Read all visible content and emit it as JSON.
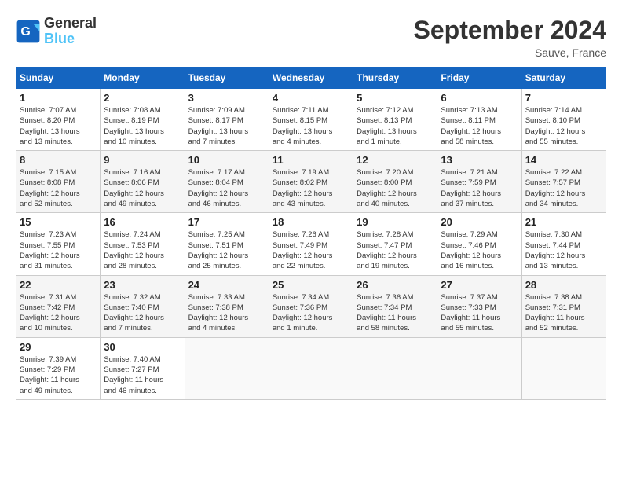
{
  "header": {
    "logo_line1": "General",
    "logo_line2": "Blue",
    "month": "September 2024",
    "location": "Sauve, France"
  },
  "weekdays": [
    "Sunday",
    "Monday",
    "Tuesday",
    "Wednesday",
    "Thursday",
    "Friday",
    "Saturday"
  ],
  "weeks": [
    [
      {
        "day": "1",
        "info": "Sunrise: 7:07 AM\nSunset: 8:20 PM\nDaylight: 13 hours\nand 13 minutes."
      },
      {
        "day": "2",
        "info": "Sunrise: 7:08 AM\nSunset: 8:19 PM\nDaylight: 13 hours\nand 10 minutes."
      },
      {
        "day": "3",
        "info": "Sunrise: 7:09 AM\nSunset: 8:17 PM\nDaylight: 13 hours\nand 7 minutes."
      },
      {
        "day": "4",
        "info": "Sunrise: 7:11 AM\nSunset: 8:15 PM\nDaylight: 13 hours\nand 4 minutes."
      },
      {
        "day": "5",
        "info": "Sunrise: 7:12 AM\nSunset: 8:13 PM\nDaylight: 13 hours\nand 1 minute."
      },
      {
        "day": "6",
        "info": "Sunrise: 7:13 AM\nSunset: 8:11 PM\nDaylight: 12 hours\nand 58 minutes."
      },
      {
        "day": "7",
        "info": "Sunrise: 7:14 AM\nSunset: 8:10 PM\nDaylight: 12 hours\nand 55 minutes."
      }
    ],
    [
      {
        "day": "8",
        "info": "Sunrise: 7:15 AM\nSunset: 8:08 PM\nDaylight: 12 hours\nand 52 minutes."
      },
      {
        "day": "9",
        "info": "Sunrise: 7:16 AM\nSunset: 8:06 PM\nDaylight: 12 hours\nand 49 minutes."
      },
      {
        "day": "10",
        "info": "Sunrise: 7:17 AM\nSunset: 8:04 PM\nDaylight: 12 hours\nand 46 minutes."
      },
      {
        "day": "11",
        "info": "Sunrise: 7:19 AM\nSunset: 8:02 PM\nDaylight: 12 hours\nand 43 minutes."
      },
      {
        "day": "12",
        "info": "Sunrise: 7:20 AM\nSunset: 8:00 PM\nDaylight: 12 hours\nand 40 minutes."
      },
      {
        "day": "13",
        "info": "Sunrise: 7:21 AM\nSunset: 7:59 PM\nDaylight: 12 hours\nand 37 minutes."
      },
      {
        "day": "14",
        "info": "Sunrise: 7:22 AM\nSunset: 7:57 PM\nDaylight: 12 hours\nand 34 minutes."
      }
    ],
    [
      {
        "day": "15",
        "info": "Sunrise: 7:23 AM\nSunset: 7:55 PM\nDaylight: 12 hours\nand 31 minutes."
      },
      {
        "day": "16",
        "info": "Sunrise: 7:24 AM\nSunset: 7:53 PM\nDaylight: 12 hours\nand 28 minutes."
      },
      {
        "day": "17",
        "info": "Sunrise: 7:25 AM\nSunset: 7:51 PM\nDaylight: 12 hours\nand 25 minutes."
      },
      {
        "day": "18",
        "info": "Sunrise: 7:26 AM\nSunset: 7:49 PM\nDaylight: 12 hours\nand 22 minutes."
      },
      {
        "day": "19",
        "info": "Sunrise: 7:28 AM\nSunset: 7:47 PM\nDaylight: 12 hours\nand 19 minutes."
      },
      {
        "day": "20",
        "info": "Sunrise: 7:29 AM\nSunset: 7:46 PM\nDaylight: 12 hours\nand 16 minutes."
      },
      {
        "day": "21",
        "info": "Sunrise: 7:30 AM\nSunset: 7:44 PM\nDaylight: 12 hours\nand 13 minutes."
      }
    ],
    [
      {
        "day": "22",
        "info": "Sunrise: 7:31 AM\nSunset: 7:42 PM\nDaylight: 12 hours\nand 10 minutes."
      },
      {
        "day": "23",
        "info": "Sunrise: 7:32 AM\nSunset: 7:40 PM\nDaylight: 12 hours\nand 7 minutes."
      },
      {
        "day": "24",
        "info": "Sunrise: 7:33 AM\nSunset: 7:38 PM\nDaylight: 12 hours\nand 4 minutes."
      },
      {
        "day": "25",
        "info": "Sunrise: 7:34 AM\nSunset: 7:36 PM\nDaylight: 12 hours\nand 1 minute."
      },
      {
        "day": "26",
        "info": "Sunrise: 7:36 AM\nSunset: 7:34 PM\nDaylight: 11 hours\nand 58 minutes."
      },
      {
        "day": "27",
        "info": "Sunrise: 7:37 AM\nSunset: 7:33 PM\nDaylight: 11 hours\nand 55 minutes."
      },
      {
        "day": "28",
        "info": "Sunrise: 7:38 AM\nSunset: 7:31 PM\nDaylight: 11 hours\nand 52 minutes."
      }
    ],
    [
      {
        "day": "29",
        "info": "Sunrise: 7:39 AM\nSunset: 7:29 PM\nDaylight: 11 hours\nand 49 minutes."
      },
      {
        "day": "30",
        "info": "Sunrise: 7:40 AM\nSunset: 7:27 PM\nDaylight: 11 hours\nand 46 minutes."
      },
      {
        "day": "",
        "info": ""
      },
      {
        "day": "",
        "info": ""
      },
      {
        "day": "",
        "info": ""
      },
      {
        "day": "",
        "info": ""
      },
      {
        "day": "",
        "info": ""
      }
    ]
  ]
}
